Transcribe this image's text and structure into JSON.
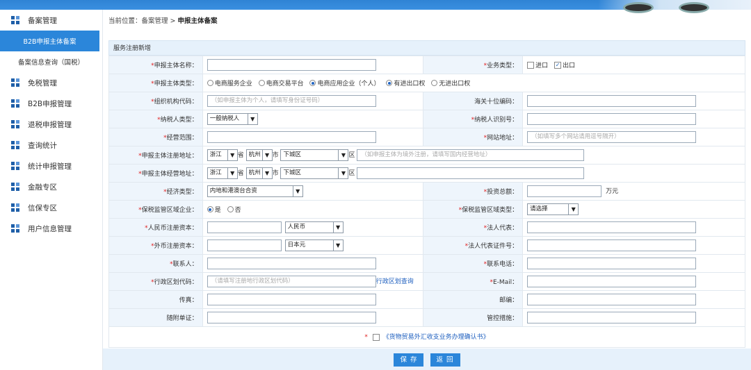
{
  "sidebar": {
    "items": [
      {
        "label": "备案管理"
      },
      {
        "label": "免税管理"
      },
      {
        "label": "B2B申报管理"
      },
      {
        "label": "退税申报管理"
      },
      {
        "label": "查询统计"
      },
      {
        "label": "统计申报管理"
      },
      {
        "label": "金融专区"
      },
      {
        "label": "信保专区"
      },
      {
        "label": "用户信息管理"
      }
    ],
    "sub_items": [
      {
        "label": "B2B申报主体备案",
        "active": true
      },
      {
        "label": "备案信息查询（国税）",
        "active": false
      }
    ]
  },
  "breadcrumb": {
    "prefix": "当前位置：备案管理",
    "sep": ">",
    "current": "申报主体备案"
  },
  "panel": {
    "title": "服务注册新增"
  },
  "form": {
    "subject_name_label": "申报主体名称：",
    "business_type_label": "业务类型：",
    "business_type_options": [
      "进口",
      "出口"
    ],
    "subject_type_label": "申报主体类型：",
    "subject_type_options": [
      "电商服务企业",
      "电商交易平台",
      "电商应用企业（个人）",
      "有进出口权",
      "无进出口权"
    ],
    "org_code_label": "组织机构代码：",
    "org_code_placeholder": "（如申报主体为个人，请填写身份证号码）",
    "customs_code_label": "海关十位编码：",
    "taxpayer_type_label": "纳税人类型：",
    "taxpayer_type_value": "一般纳税人",
    "taxpayer_id_label": "纳税人识别号：",
    "scope_label": "经营范围：",
    "website_label": "网站地址：",
    "website_placeholder": "（如填写多个网站请用逗号隔开）",
    "reg_address_label": "申报主体注册地址：",
    "biz_address_label": "申报主体经营地址：",
    "province": "浙江",
    "province_unit": "省",
    "city": "杭州",
    "city_unit": "市",
    "district": "下城区",
    "district_unit": "区",
    "reg_address_placeholder": "（如申报主体为境外注册，请填写国内经营地址）",
    "economy_type_label": "经济类型：",
    "economy_type_value": "内地和港澳台合资",
    "investment_label": "投资总额：",
    "investment_unit": "万元",
    "bonded_label": "保税监管区域企业：",
    "bonded_options": [
      "是",
      "否"
    ],
    "bonded_type_label": "保税监管区域类型：",
    "bonded_type_value": "请选择",
    "rmb_capital_label": "人民币注册资本：",
    "rmb_currency": "人民币",
    "legal_rep_label": "法人代表：",
    "foreign_capital_label": "外币注册资本：",
    "foreign_currency": "日本元",
    "legal_rep_id_label": "法人代表证件号：",
    "contact_label": "联系人：",
    "phone_label": "联系电话：",
    "region_code_label": "行政区划代码：",
    "region_code_placeholder": "（请填写注册地行政区划代码）",
    "region_code_link": "行政区划查询",
    "email_label": "E-Mail：",
    "fax_label": "传真：",
    "postcode_label": "邮编：",
    "attached_label": "随附单证：",
    "control_label": "管控措施：",
    "confirm_text": "《货物贸易外汇收支业务办理确认书》"
  },
  "footer": {
    "save_label": "保 存",
    "back_label": "返 回"
  }
}
